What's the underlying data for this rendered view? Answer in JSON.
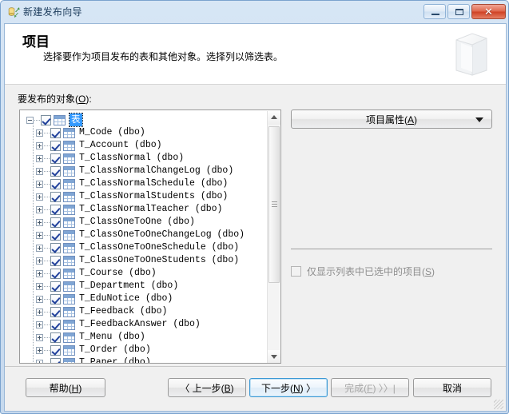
{
  "window": {
    "title": "新建发布向导",
    "icon": "database-publish-icon",
    "controls": {
      "minimize": "minimize-icon",
      "maximize": "maximize-icon",
      "close": "✕"
    }
  },
  "header": {
    "title": "项目",
    "subtitle": "选择要作为项目发布的表和其他对象。选择列以筛选表。",
    "graphic": "book-3d-icon"
  },
  "body": {
    "tree_label": "要发布的对象",
    "tree_label_accel": "O",
    "tree_label_suffix": ":",
    "root": {
      "label": "表",
      "checked": true,
      "expanded": true,
      "selected": true
    },
    "items": [
      {
        "label": "M_Code  (dbo)",
        "checked": true
      },
      {
        "label": "T_Account  (dbo)",
        "checked": true
      },
      {
        "label": "T_ClassNormal  (dbo)",
        "checked": true
      },
      {
        "label": "T_ClassNormalChangeLog  (dbo)",
        "checked": true
      },
      {
        "label": "T_ClassNormalSchedule  (dbo)",
        "checked": true
      },
      {
        "label": "T_ClassNormalStudents  (dbo)",
        "checked": true
      },
      {
        "label": "T_ClassNormalTeacher  (dbo)",
        "checked": true
      },
      {
        "label": "T_ClassOneToOne  (dbo)",
        "checked": true
      },
      {
        "label": "T_ClassOneToOneChangeLog  (dbo)",
        "checked": true
      },
      {
        "label": "T_ClassOneToOneSchedule  (dbo)",
        "checked": true
      },
      {
        "label": "T_ClassOneToOneStudents  (dbo)",
        "checked": true
      },
      {
        "label": "T_Course  (dbo)",
        "checked": true
      },
      {
        "label": "T_Department  (dbo)",
        "checked": true
      },
      {
        "label": "T_EduNotice  (dbo)",
        "checked": true
      },
      {
        "label": "T_Feedback  (dbo)",
        "checked": true
      },
      {
        "label": "T_FeedbackAnswer  (dbo)",
        "checked": true
      },
      {
        "label": "T_Menu  (dbo)",
        "checked": true
      },
      {
        "label": "T_Order  (dbo)",
        "checked": true
      },
      {
        "label": "T_Paper  (dbo)",
        "checked": true
      }
    ],
    "properties_button": "项目属性",
    "properties_button_accel": "A",
    "show_selected_only": "仅显示列表中已选中的项目",
    "show_selected_only_accel": "S",
    "show_selected_only_checked": false,
    "show_selected_only_enabled": false
  },
  "footer": {
    "help": "帮助",
    "help_accel": "H",
    "back": "〈 上一步",
    "back_accel": "B",
    "next": "下一步",
    "next_accel": "N",
    "next_suffix": " 〉",
    "finish": "完成",
    "finish_accel": "F",
    "finish_suffix": " 〉〉|",
    "cancel": "取消"
  },
  "colors": {
    "frame": "#c6d9ee",
    "frame_border": "#7ba3ce",
    "header_bg": "#ffffff",
    "body_bg": "#f0f0f0",
    "selection": "#3399ff",
    "close_btn": "#cf4326",
    "focus_ring": "#3c99d4"
  }
}
